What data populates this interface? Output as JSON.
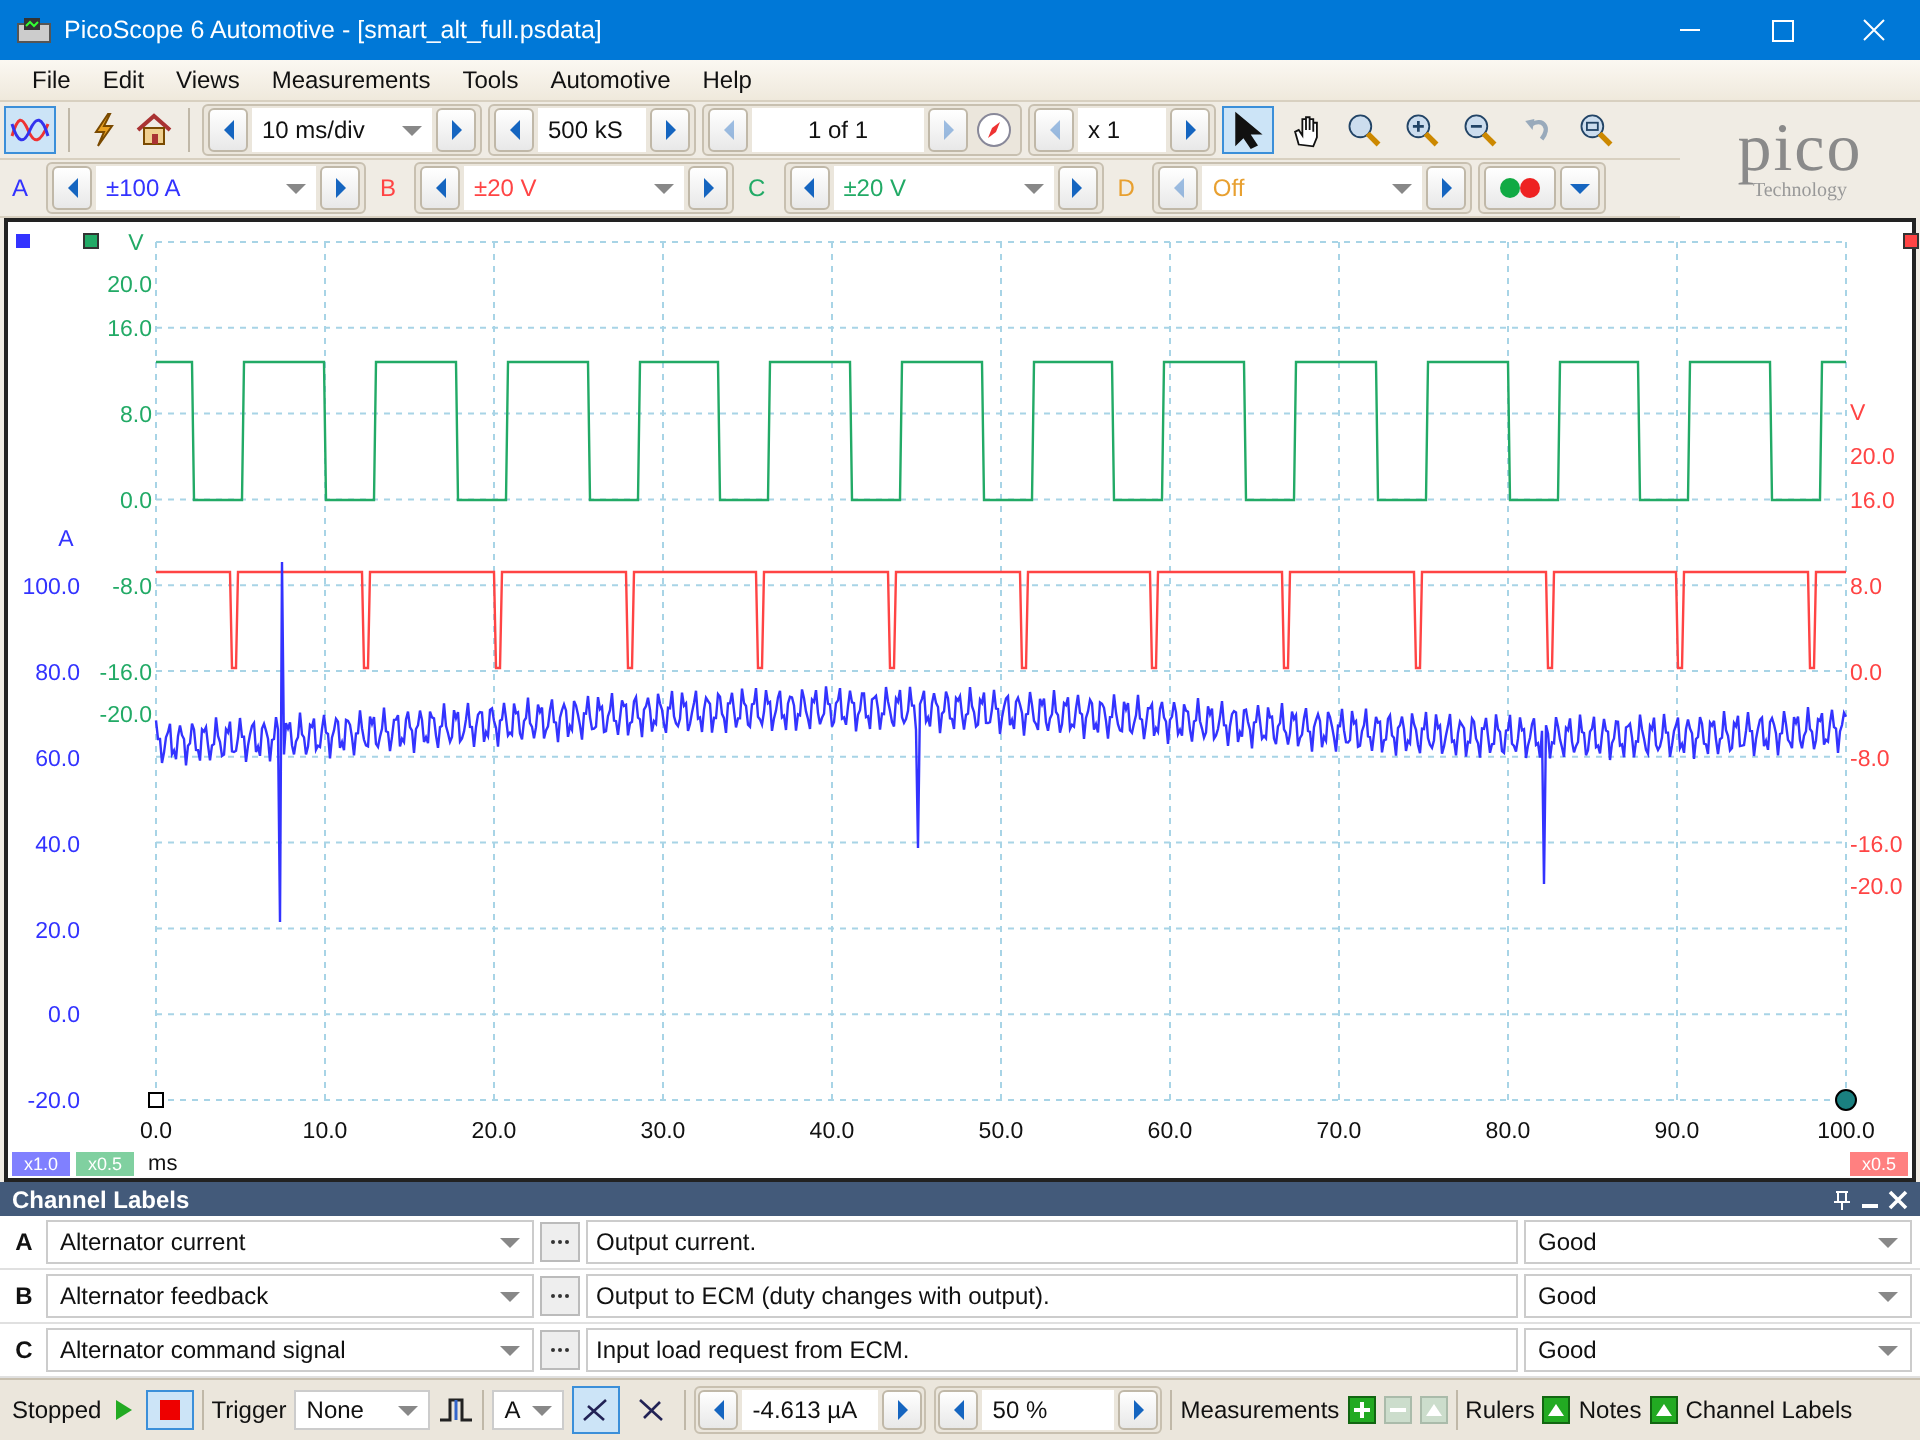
{
  "window": {
    "title": "PicoScope 6 Automotive - [smart_alt_full.psdata]"
  },
  "menu": [
    "File",
    "Edit",
    "Views",
    "Measurements",
    "Tools",
    "Automotive",
    "Help"
  ],
  "toolbar": {
    "scope_mode_selected": true,
    "timebase": "10 ms/div",
    "samples": "500 kS",
    "buffer": "1 of 1",
    "zoom": "x 1",
    "tools": [
      {
        "kind": "pointer",
        "selected": true
      },
      {
        "kind": "hand",
        "selected": false
      },
      {
        "kind": "zoom",
        "selected": false
      },
      {
        "kind": "zoom-in",
        "selected": false
      },
      {
        "kind": "zoom-out",
        "selected": false
      },
      {
        "kind": "undo",
        "selected": false
      },
      {
        "kind": "zoom-fit",
        "selected": false
      }
    ]
  },
  "logo": {
    "name": "pico",
    "tagline": "Technology"
  },
  "channels": [
    {
      "letter": "A",
      "range": "±100 A",
      "color": "#3333ff"
    },
    {
      "letter": "B",
      "range": "±20 V",
      "color": "#ff4444"
    },
    {
      "letter": "C",
      "range": "±20 V",
      "color": "#22aa66"
    },
    {
      "letter": "D",
      "range": "Off",
      "color": "#e8a030"
    }
  ],
  "plot": {
    "axes": [
      {
        "unit": "A",
        "color": "#3333ff",
        "labels": [
          "100.0",
          "80.0",
          "60.0",
          "40.0",
          "20.0",
          "0.0",
          "-20.0"
        ]
      },
      {
        "unit": "V",
        "color": "#22aa66",
        "labels": [
          "20.0",
          "16.0",
          "8.0",
          "0.0",
          "-8.0",
          "-16.0",
          "-20.0"
        ]
      },
      {
        "unit": "V",
        "color": "#ff4444",
        "labels": [
          "20.0",
          "16.0",
          "8.0",
          "0.0",
          "-8.0",
          "-16.0",
          "-20.0"
        ]
      }
    ],
    "time_labels": [
      "0.0",
      "10.0",
      "20.0",
      "30.0",
      "40.0",
      "50.0",
      "60.0",
      "70.0",
      "80.0",
      "90.0",
      "100.0"
    ],
    "time_unit": "ms",
    "scale_badges": [
      {
        "text": "x1.0",
        "color": "#8080ff"
      },
      {
        "text": "x0.5",
        "color": "#80d0a0"
      },
      {
        "text": "x0.5",
        "color": "#ff8080"
      }
    ]
  },
  "channel_labels": {
    "title": "Channel Labels",
    "rows": [
      {
        "letter": "A",
        "name": "Alternator current",
        "description": "Output current.",
        "status": "Good"
      },
      {
        "letter": "B",
        "name": "Alternator feedback",
        "description": "Output to ECM (duty changes with output).",
        "status": "Good"
      },
      {
        "letter": "C",
        "name": "Alternator command signal",
        "description": "Input load request from ECM.",
        "status": "Good"
      }
    ]
  },
  "status_bar": {
    "state": "Stopped",
    "stopped": true,
    "trigger_label": "Trigger",
    "trigger_mode": "None",
    "trigger_channel": "A",
    "rising_selected": true,
    "threshold": "-4.613 µA",
    "pretrigger": "50 %",
    "measurements": "Measurements",
    "rulers": "Rulers",
    "notes": "Notes",
    "channel_labels": "Channel Labels"
  }
}
